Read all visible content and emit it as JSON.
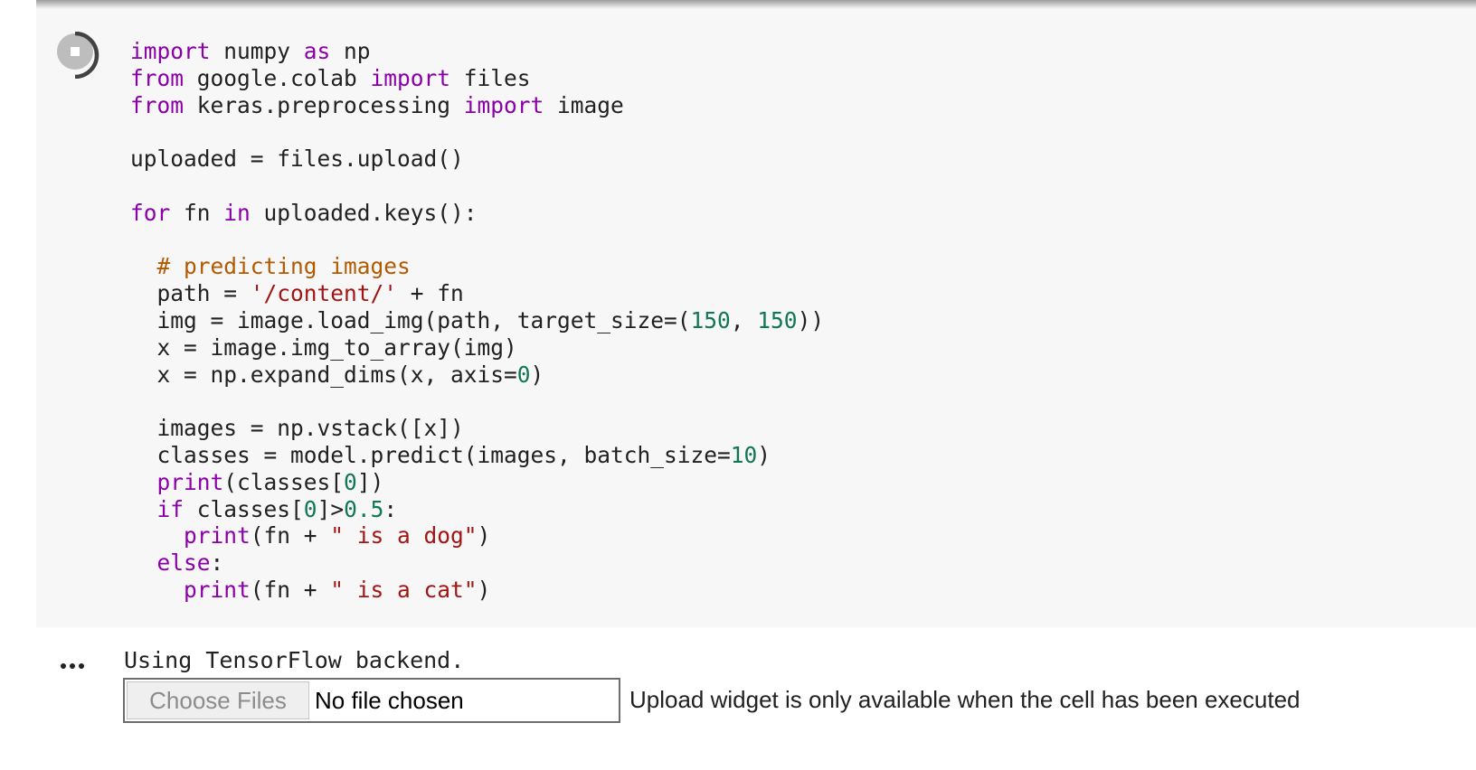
{
  "code_cell": {
    "run_button_icon": "stop-icon",
    "lines": [
      [
        {
          "t": "import",
          "c": "kw"
        },
        {
          "t": " numpy "
        },
        {
          "t": "as",
          "c": "kw"
        },
        {
          "t": " np"
        }
      ],
      [
        {
          "t": "from",
          "c": "kw"
        },
        {
          "t": " google.colab "
        },
        {
          "t": "import",
          "c": "kw"
        },
        {
          "t": " files"
        }
      ],
      [
        {
          "t": "from",
          "c": "kw"
        },
        {
          "t": " keras.preprocessing "
        },
        {
          "t": "import",
          "c": "kw"
        },
        {
          "t": " image"
        }
      ],
      [],
      [
        {
          "t": "uploaded = files.upload()"
        }
      ],
      [],
      [
        {
          "t": "for",
          "c": "kw"
        },
        {
          "t": " fn "
        },
        {
          "t": "in",
          "c": "kw"
        },
        {
          "t": " uploaded.keys():"
        }
      ],
      [],
      [
        {
          "t": "  "
        },
        {
          "t": "# predicting images",
          "c": "cm"
        }
      ],
      [
        {
          "t": "  path = "
        },
        {
          "t": "'/content/'",
          "c": "st"
        },
        {
          "t": " + fn"
        }
      ],
      [
        {
          "t": "  img = image.load_img(path, target_size=("
        },
        {
          "t": "150",
          "c": "nm"
        },
        {
          "t": ", "
        },
        {
          "t": "150",
          "c": "nm"
        },
        {
          "t": "))"
        }
      ],
      [
        {
          "t": "  x = image.img_to_array(img)"
        }
      ],
      [
        {
          "t": "  x = np.expand_dims(x, axis="
        },
        {
          "t": "0",
          "c": "nm"
        },
        {
          "t": ")"
        }
      ],
      [],
      [
        {
          "t": "  images = np.vstack([x])"
        }
      ],
      [
        {
          "t": "  classes = model.predict(images, batch_size="
        },
        {
          "t": "10",
          "c": "nm"
        },
        {
          "t": ")"
        }
      ],
      [
        {
          "t": "  "
        },
        {
          "t": "print",
          "c": "kw"
        },
        {
          "t": "(classes["
        },
        {
          "t": "0",
          "c": "nm"
        },
        {
          "t": "])"
        }
      ],
      [
        {
          "t": "  "
        },
        {
          "t": "if",
          "c": "kw"
        },
        {
          "t": " classes["
        },
        {
          "t": "0",
          "c": "nm"
        },
        {
          "t": "]>"
        },
        {
          "t": "0.5",
          "c": "nm"
        },
        {
          "t": ":"
        }
      ],
      [
        {
          "t": "    "
        },
        {
          "t": "print",
          "c": "kw"
        },
        {
          "t": "(fn + "
        },
        {
          "t": "\" is a dog\"",
          "c": "st"
        },
        {
          "t": ")"
        }
      ],
      [
        {
          "t": "  "
        },
        {
          "t": "else",
          "c": "kw"
        },
        {
          "t": ":"
        }
      ],
      [
        {
          "t": "    "
        },
        {
          "t": "print",
          "c": "kw"
        },
        {
          "t": "(fn + "
        },
        {
          "t": "\" is a cat\"",
          "c": "st"
        },
        {
          "t": ")"
        }
      ]
    ]
  },
  "output": {
    "menu_icon": "more-horizontal-icon",
    "text": "Using TensorFlow backend.",
    "choose_files_label": "Choose Files",
    "file_status": "No file chosen",
    "note": "Upload widget is only available when the cell has been executed"
  },
  "colors": {
    "cell_background": "#f7f7f7",
    "keyword": "#8b00a8",
    "comment": "#b35900",
    "string": "#a31515",
    "number": "#117755"
  }
}
